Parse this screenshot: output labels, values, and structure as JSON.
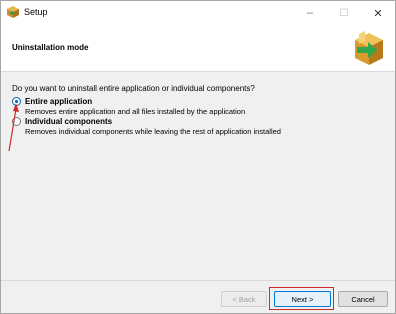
{
  "window": {
    "title": "Setup",
    "icon": "installer-box-icon",
    "controls": {
      "minimize": "–",
      "maximize": "☐",
      "close": "✕"
    }
  },
  "header": {
    "title": "Uninstallation mode",
    "graphic": "box-arrow-icon"
  },
  "body": {
    "question": "Do you want to uninstall entire application or individual components?",
    "options": [
      {
        "label": "Entire application",
        "description": "Removes entire application and all files installed by the application",
        "selected": true
      },
      {
        "label": "Individual components",
        "description": "Removes individual components while leaving the rest of application installed",
        "selected": false
      }
    ]
  },
  "footer": {
    "back_label": "< Back",
    "next_label": "Next >",
    "cancel_label": "Cancel",
    "back_enabled": false
  },
  "colors": {
    "accent": "#0063b1",
    "annotation": "#cc2b2b"
  }
}
